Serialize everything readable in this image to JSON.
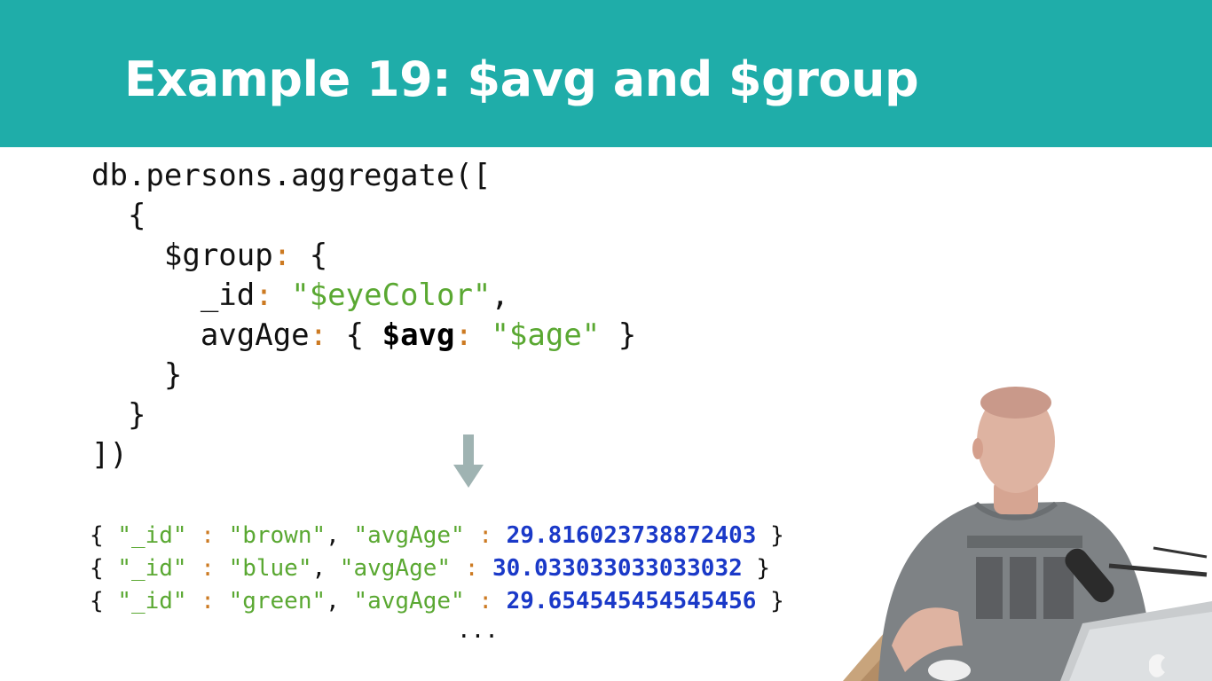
{
  "slide": {
    "title": "Example 19: $avg and $group"
  },
  "code": {
    "l1_text": "db.persons.aggregate([",
    "l2_brace": "{",
    "l3_key": "$group",
    "colon": ":",
    "l3_brace": "{",
    "l4_key": "_id",
    "l4_value": "\"$eyeColor\"",
    "l4_comma": ",",
    "l5_key": "avgAge",
    "l5_open": "{",
    "l5_op": "$avg",
    "l5_value": "\"$age\"",
    "l5_close": "}",
    "l6_brace": "}",
    "l7_brace": "}",
    "l8_text": "])"
  },
  "results": {
    "rows": [
      {
        "id_key": "\"_id\"",
        "id_value": "\"brown\"",
        "avg_key": "\"avgAge\"",
        "avg_value": "29.816023738872403"
      },
      {
        "id_key": "\"_id\"",
        "id_value": "\"blue\"",
        "avg_key": "\"avgAge\"",
        "avg_value": "30.033033033033032"
      },
      {
        "id_key": "\"_id\"",
        "id_value": "\"green\"",
        "avg_key": "\"avgAge\"",
        "avg_value": "29.654545454545456"
      }
    ],
    "open_brace": "{",
    "close_brace": "}",
    "colon": ":",
    "comma": ",",
    "ellipsis": "..."
  },
  "icons": {
    "arrow": "arrow-down-icon"
  },
  "colors": {
    "header_bg": "#1fada9",
    "string": "#5aa832",
    "punctuation": "#cc7a22",
    "number": "#1a39c8"
  }
}
